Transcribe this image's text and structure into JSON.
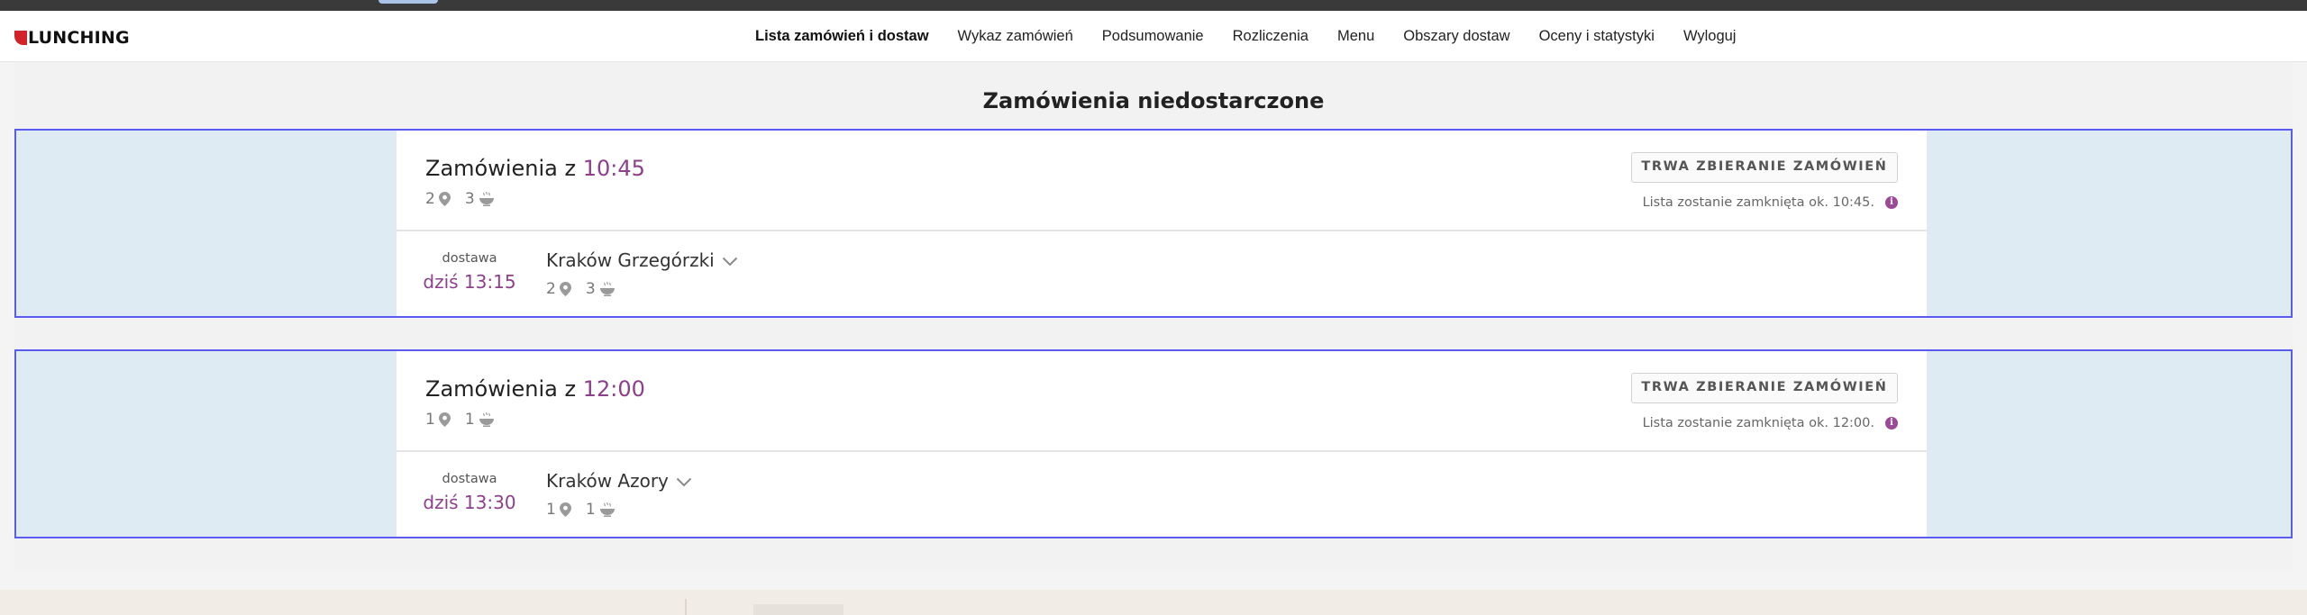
{
  "app": {
    "logo_text": "LUNCHING"
  },
  "nav": {
    "items": [
      {
        "label": "Lista zamówień i dostaw",
        "active": true
      },
      {
        "label": "Wykaz zamówień",
        "active": false
      },
      {
        "label": "Podsumowanie",
        "active": false
      },
      {
        "label": "Rozliczenia",
        "active": false
      },
      {
        "label": "Menu",
        "active": false
      },
      {
        "label": "Obszary dostaw",
        "active": false
      },
      {
        "label": "Oceny i statystyki",
        "active": false
      },
      {
        "label": "Wyloguj",
        "active": false
      }
    ]
  },
  "page": {
    "title": "Zamówienia niedostarczone"
  },
  "groups": [
    {
      "title_prefix": "Zamówienia z",
      "time": "10:45",
      "locations_count": "2",
      "meals_count": "3",
      "status_label": "TRWA ZBIERANIE ZAMÓWIEŃ",
      "status_note": "Lista zostanie zamknięta ok. 10:45.",
      "delivery": {
        "label": "dostawa",
        "time": "dziś 13:15",
        "location": "Kraków Grzegórzki",
        "locations_count": "2",
        "meals_count": "3"
      }
    },
    {
      "title_prefix": "Zamówienia z",
      "time": "12:00",
      "locations_count": "1",
      "meals_count": "1",
      "status_label": "TRWA ZBIERANIE ZAMÓWIEŃ",
      "status_note": "Lista zostanie zamknięta ok. 12:00.",
      "delivery": {
        "label": "dostawa",
        "time": "dziś 13:30",
        "location": "Kraków Azory",
        "locations_count": "1",
        "meals_count": "1"
      }
    }
  ],
  "icons": {
    "pin": "map-pin-icon",
    "meal": "bowl-icon",
    "info": "info-icon",
    "chevron": "chevron-down-icon"
  },
  "colors": {
    "accent": "#8e3f8b",
    "group_border": "#5b5bf0",
    "group_bg": "#deebf2",
    "brand_red": "#d2232a"
  }
}
